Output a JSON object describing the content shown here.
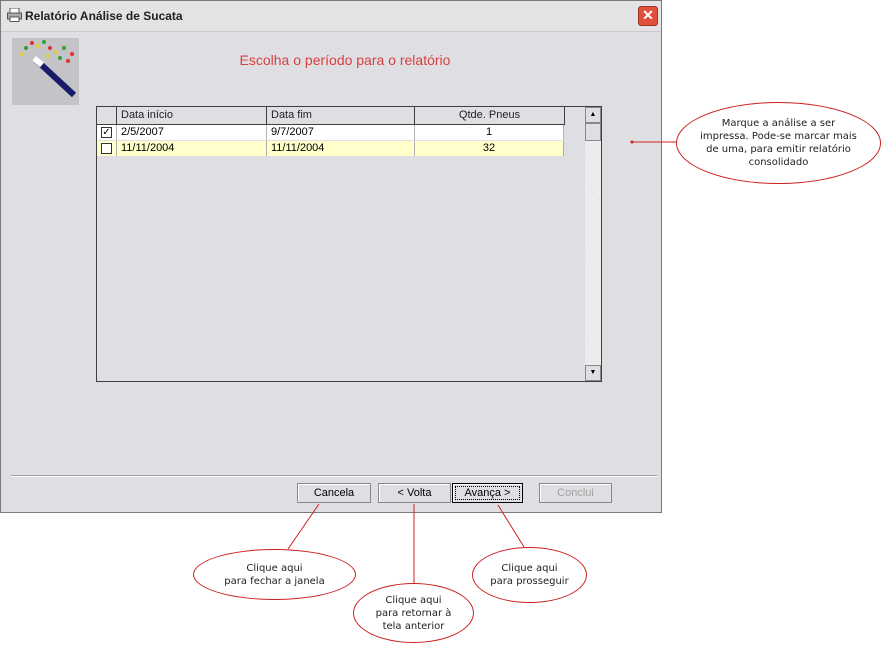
{
  "window": {
    "title": "Relatório Análise de Sucata",
    "close_symbol": "✕"
  },
  "heading": "Escolha o período para o relatório",
  "grid": {
    "columns": [
      "",
      "Data início",
      "Data fim",
      "Qtde. Pneus"
    ],
    "rows": [
      {
        "checked": true,
        "start": "2/5/2007",
        "end": "9/7/2007",
        "qty": "1",
        "check_mark": "✓"
      },
      {
        "checked": false,
        "start": "11/11/2004",
        "end": "11/11/2004",
        "qty": "32",
        "check_mark": ""
      }
    ],
    "selected_row_color": "#ffffcc"
  },
  "buttons": {
    "cancel": "Cancela",
    "back": "< Volta",
    "next": "Avança >",
    "finish": "Conclui"
  },
  "callouts": {
    "mark": "Marque a análise a ser\nimpressa. Pode-se marcar mais\nde uma, para emitir relatório\nconsolidado",
    "close": "Clique aqui\npara fechar a janela",
    "back": "Clique aqui\npara retornar à\ntela anterior",
    "next": "Clique aqui\npara prosseguir"
  },
  "colors": {
    "callout_border": "#cc2020",
    "heading": "#d84040"
  }
}
